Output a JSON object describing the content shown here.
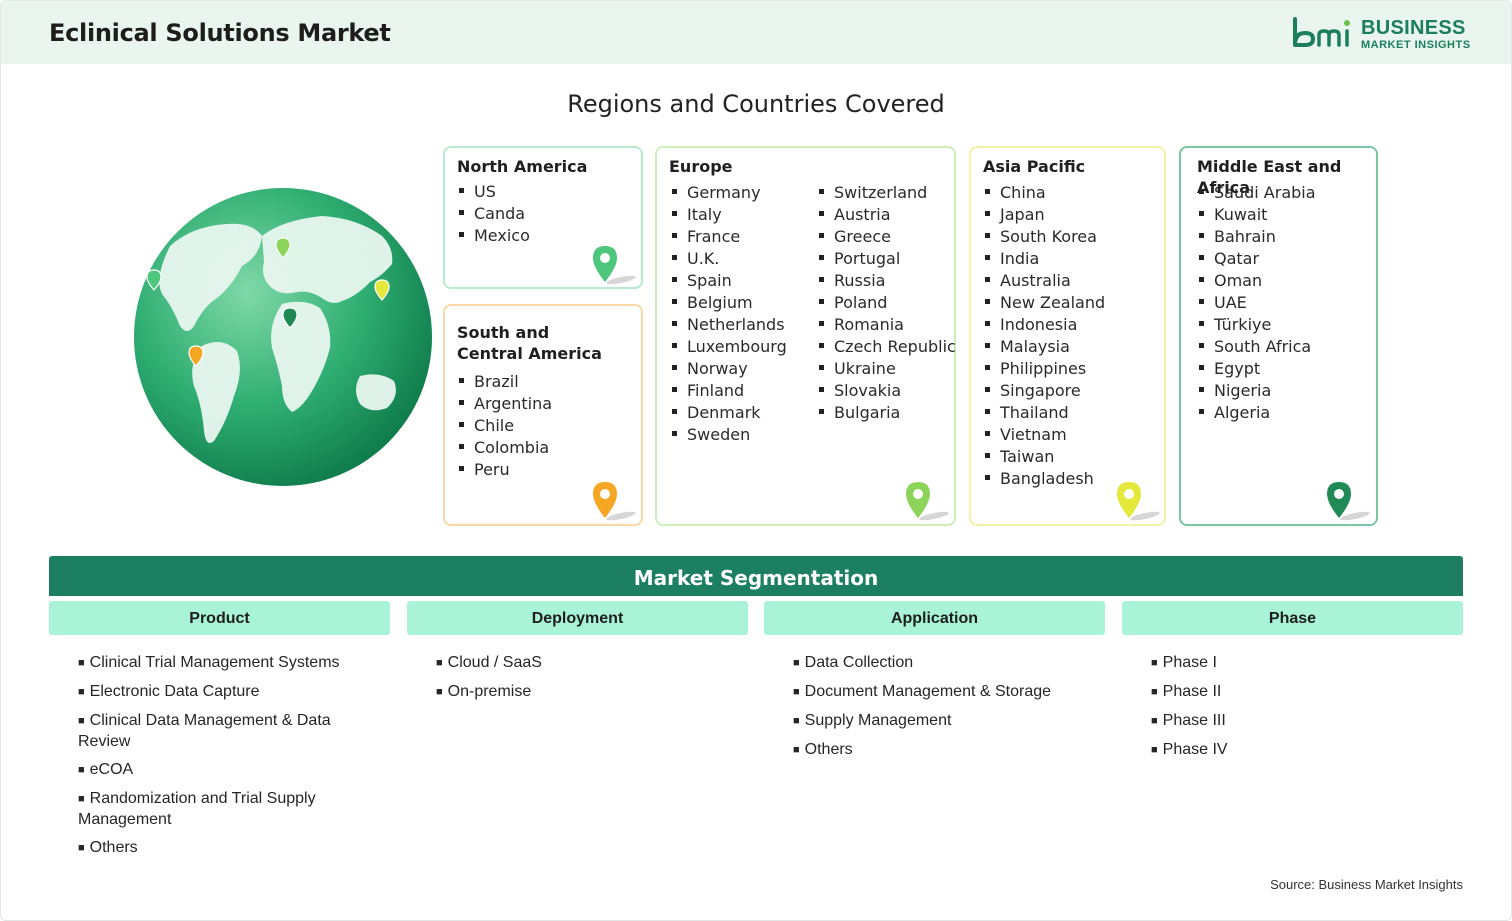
{
  "header": {
    "title": "Eclinical Solutions Market",
    "logo_line1": "BUSINESS",
    "logo_line2": "MARKET INSIGHTS"
  },
  "regions": {
    "title": "Regions and Countries Covered",
    "north_america": {
      "name": "North America",
      "countries": [
        "US",
        "Canda",
        "Mexico"
      ],
      "color": "#4cc77d"
    },
    "south_central_america": {
      "name_line1": "South and",
      "name_line2": "Central America",
      "countries": [
        "Brazil",
        "Argentina",
        "Chile",
        "Colombia",
        "Peru"
      ],
      "color": "#f5a623"
    },
    "europe": {
      "name": "Europe",
      "countries_col1": [
        "Germany",
        "Italy",
        "France",
        "U.K.",
        "Spain",
        "Belgium",
        "Netherlands",
        "Luxembourg",
        "Norway",
        "Finland",
        "Denmark",
        "Sweden"
      ],
      "countries_col2": [
        "Switzerland",
        "Austria",
        "Greece",
        "Portugal",
        "Russia",
        "Poland",
        "Romania",
        "Czech Republic",
        "Ukraine",
        "Slovakia",
        "Bulgaria"
      ],
      "color": "#8cd45a"
    },
    "asia_pacific": {
      "name": "Asia Pacific",
      "countries": [
        "China",
        "Japan",
        "South Korea",
        "India",
        "Australia",
        "New Zealand",
        "Indonesia",
        "Malaysia",
        "Philippines",
        "Singapore",
        "Thailand",
        "Vietnam",
        "Taiwan",
        "Bangladesh"
      ],
      "color": "#e4e83a"
    },
    "mea": {
      "name": "Middle East and Africa",
      "countries": [
        "Saudi Arabia",
        "Kuwait",
        "Bahrain",
        "Qatar",
        "Oman",
        "UAE",
        "Türkiye",
        "South Africa",
        "Egypt",
        "Nigeria",
        "Algeria"
      ],
      "color": "#1f8a55"
    }
  },
  "segmentation": {
    "title": "Market Segmentation",
    "product": {
      "label": "Product",
      "items": [
        "Clinical Trial Management Systems",
        "Electronic Data Capture",
        "Clinical Data Management & Data Review",
        "eCOA",
        "Randomization and Trial Supply Management",
        "Others"
      ]
    },
    "deployment": {
      "label": "Deployment",
      "items": [
        "Cloud / SaaS",
        "On-premise"
      ]
    },
    "application": {
      "label": "Application",
      "items": [
        "Data Collection",
        "Document Management & Storage",
        "Supply Management",
        "Others"
      ]
    },
    "phase": {
      "label": "Phase",
      "items": [
        "Phase I",
        "Phase II",
        "Phase III",
        "Phase IV"
      ]
    }
  },
  "source": "Source: Business Market Insights"
}
